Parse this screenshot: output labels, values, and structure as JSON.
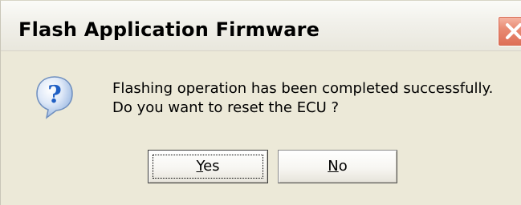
{
  "dialog": {
    "title": "Flash Application Firmware",
    "close_icon": "close-icon",
    "message_icon": "question-icon",
    "message_line1": "Flashing operation has been completed successfully.",
    "message_line2": "Do you want to reset the ECU ?"
  },
  "buttons": {
    "yes": {
      "mnemonic": "Y",
      "rest": "es",
      "focused": true
    },
    "no": {
      "mnemonic": "N",
      "rest": "o",
      "focused": false
    }
  },
  "colors": {
    "dialog_background": "#ece9d8",
    "close_button": "#e4806a",
    "question_icon": "#1f5fc4"
  }
}
